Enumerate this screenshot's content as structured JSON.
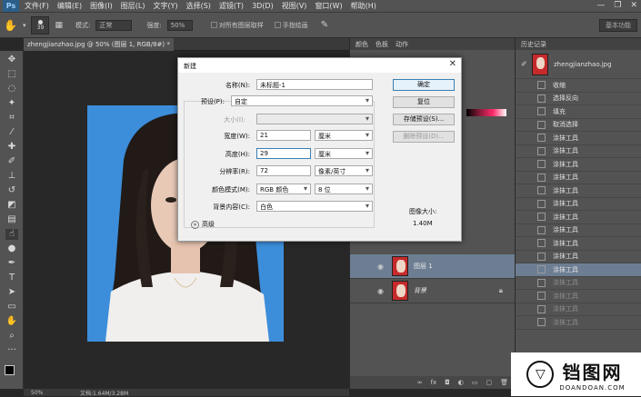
{
  "app": {
    "logo": "Ps"
  },
  "menu": [
    "文件(F)",
    "编辑(E)",
    "图像(I)",
    "图层(L)",
    "文字(Y)",
    "选择(S)",
    "滤镜(T)",
    "3D(D)",
    "视图(V)",
    "窗口(W)",
    "帮助(H)"
  ],
  "window_controls": {
    "minimize": "—",
    "restore": "❐",
    "close": "✕"
  },
  "options": {
    "brush_size": "39",
    "mode_label": "模式:",
    "mode_value": "正常",
    "opacity_label": "强度:",
    "opacity_value": "50%",
    "sample_all_label": "对所有图层取样",
    "finger_label": "手指绘画",
    "workspace": "基本功能"
  },
  "document": {
    "tab_title": "zhengjianzhao.jpg @ 50% (图层 1, RGB/8#) *",
    "zoom": "50%",
    "doc_size": "文档:1.64M/3.28M"
  },
  "panels": {
    "color_tabs": [
      "颜色",
      "色板",
      "动作"
    ],
    "history_title": "历史记录",
    "history_snapshot": "zhengjianzhao.jpg",
    "history_items": [
      {
        "label": "收缩",
        "state": "normal"
      },
      {
        "label": "选择反向",
        "state": "normal"
      },
      {
        "label": "填充",
        "state": "normal"
      },
      {
        "label": "取消选择",
        "state": "normal"
      },
      {
        "label": "涂抹工具",
        "state": "normal"
      },
      {
        "label": "涂抹工具",
        "state": "normal"
      },
      {
        "label": "涂抹工具",
        "state": "normal"
      },
      {
        "label": "涂抹工具",
        "state": "normal"
      },
      {
        "label": "涂抹工具",
        "state": "normal"
      },
      {
        "label": "涂抹工具",
        "state": "normal"
      },
      {
        "label": "涂抹工具",
        "state": "normal"
      },
      {
        "label": "涂抹工具",
        "state": "normal"
      },
      {
        "label": "涂抹工具",
        "state": "normal"
      },
      {
        "label": "涂抹工具",
        "state": "normal"
      },
      {
        "label": "涂抹工具",
        "state": "selected"
      },
      {
        "label": "涂抹工具",
        "state": "dim"
      },
      {
        "label": "涂抹工具",
        "state": "dim"
      },
      {
        "label": "涂抹工具",
        "state": "dim"
      },
      {
        "label": "涂抹工具",
        "state": "dim"
      }
    ],
    "layers": [
      {
        "name": "图层 1",
        "selected": true,
        "locked": false
      },
      {
        "name": "背景",
        "selected": false,
        "locked": true
      }
    ]
  },
  "dialog": {
    "title": "新建",
    "close": "✕",
    "fields": {
      "name_label": "名称(N):",
      "name_value": "未标题-1",
      "preset_label": "预设(P):",
      "preset_value": "自定",
      "size_label": "大小(I):",
      "size_value": "",
      "width_label": "宽度(W):",
      "width_value": "21",
      "width_unit": "厘米",
      "height_label": "高度(H):",
      "height_value": "29",
      "height_unit": "厘米",
      "res_label": "分辨率(R):",
      "res_value": "72",
      "res_unit": "像素/英寸",
      "mode_label": "颜色模式(M):",
      "mode_value": "RGB 颜色",
      "bit_value": "8 位",
      "bg_label": "背景内容(C):",
      "bg_value": "白色",
      "advanced": "高级"
    },
    "buttons": {
      "ok": "确定",
      "reset": "复位",
      "save_preset": "存储预设(S)...",
      "delete_preset": "删除预设(D)..."
    },
    "image_size_label": "图像大小:",
    "image_size_value": "1.40M"
  },
  "watermark": {
    "brand": "铛图网",
    "url": "DOANDOAN.COM"
  }
}
